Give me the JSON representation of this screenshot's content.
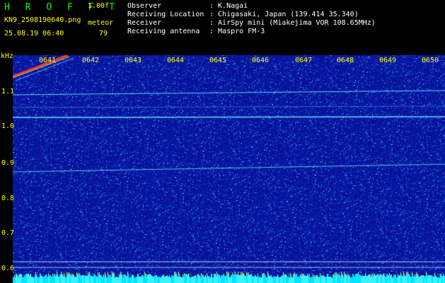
{
  "app": {
    "title": "H R O F F T",
    "version": "1.00f",
    "filename": "KN9_2508190640.png",
    "timestamp": "25.08.19 06:40",
    "meteor_label": "meteor",
    "meteor_count": "79"
  },
  "info": {
    "rows": [
      {
        "label": "Observer",
        "value": ": K.Nagai"
      },
      {
        "label": "Receiving Location",
        "value": ": Chigasaki, Japan (139.414 35.340)"
      },
      {
        "label": "Receiver",
        "value": ": AirSpy mini (Miakejima VOR 108.65MHz)"
      },
      {
        "label": "Receiving antenna",
        "value": ": Maspro FM-3"
      }
    ]
  },
  "axis": {
    "unit": "kHz",
    "time_ticks": [
      "0641",
      "0642",
      "0643",
      "0644",
      "0645",
      "0646",
      "0647",
      "0648",
      "0649",
      "0650"
    ],
    "freq_ticks": [
      "1.1",
      "1.0",
      "0.9",
      "0.8",
      "0.7",
      "0.6"
    ]
  },
  "colors": {
    "background": "#000000",
    "spectro_base": "#08129a",
    "label_yellow": "#ffff00",
    "title_green": "#00ff00",
    "signal_cyan": "#5fe0ff"
  }
}
